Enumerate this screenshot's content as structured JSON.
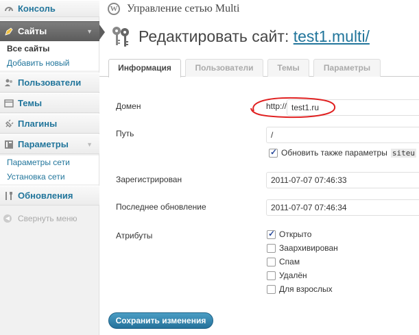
{
  "network_title": "Управление сетью Multi",
  "page": {
    "title_prefix": "Редактировать сайт:",
    "site_link": "test1.multi/"
  },
  "sidebar": {
    "console": "Консоль",
    "sites": "Сайты",
    "sites_sub": [
      "Все сайты",
      "Добавить новый"
    ],
    "users": "Пользователи",
    "themes": "Темы",
    "plugins": "Плагины",
    "settings": "Параметры",
    "settings_sub": [
      "Параметры сети",
      "Установка сети"
    ],
    "updates": "Обновления",
    "collapse": "Свернуть меню"
  },
  "tabs": [
    "Информация",
    "Пользователи",
    "Темы",
    "Параметры"
  ],
  "form": {
    "domain_label": "Домен",
    "domain_prefix": "http://",
    "domain_value": "test1.ru",
    "path_label": "Путь",
    "path_value": "/",
    "update_params_label": "Обновить также параметры",
    "update_params_code": "siteu",
    "registered_label": "Зарегистрирован",
    "registered_value": "2011-07-07 07:46:33",
    "updated_label": "Последнее обновление",
    "updated_value": "2011-07-07 07:46:34",
    "attributes_label": "Атрибуты",
    "attributes": [
      {
        "label": "Открыто",
        "checked": true
      },
      {
        "label": "Заархивирован",
        "checked": false
      },
      {
        "label": "Спам",
        "checked": false
      },
      {
        "label": "Удалён",
        "checked": false
      },
      {
        "label": "Для взрослых",
        "checked": false
      }
    ]
  },
  "save_label": "Сохранить изменения",
  "colors": {
    "link": "#21759b",
    "button": "#2e84b0",
    "annotation": "#e02020"
  }
}
